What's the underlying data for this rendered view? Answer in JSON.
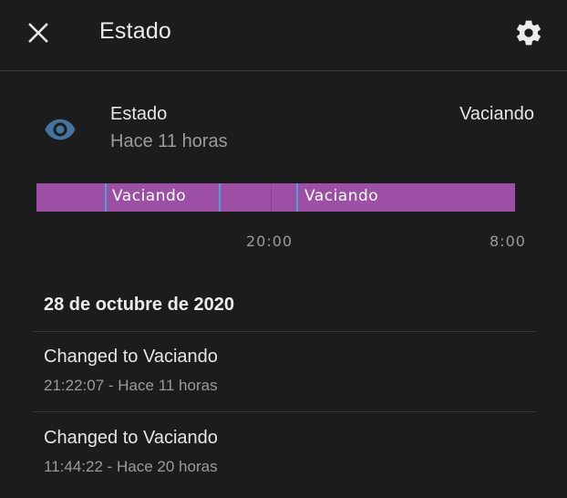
{
  "header": {
    "title": "Estado",
    "close_icon": "close-icon",
    "settings_icon": "gear-icon"
  },
  "entity": {
    "icon": "eye-icon",
    "icon_color": "#44739e",
    "name": "Estado",
    "last_changed": "Hace 11 horas",
    "state": "Vaciando"
  },
  "timeline": {
    "bar_color": "#9c4fa5",
    "separator_color": "#4aa3d8",
    "segments": [
      {
        "label": ""
      },
      {
        "label": "Vaciando"
      },
      {
        "label": ""
      },
      {
        "label": "Vaciando"
      }
    ],
    "ticks": [
      "20:00",
      "8:00"
    ]
  },
  "logbook": {
    "date": "28 de octubre de 2020",
    "entries": [
      {
        "message": "Changed to Vaciando",
        "detail": "21:22:07 - Hace 11 horas"
      },
      {
        "message": "Changed to Vaciando",
        "detail": "11:44:22 - Hace 20 horas"
      }
    ]
  }
}
